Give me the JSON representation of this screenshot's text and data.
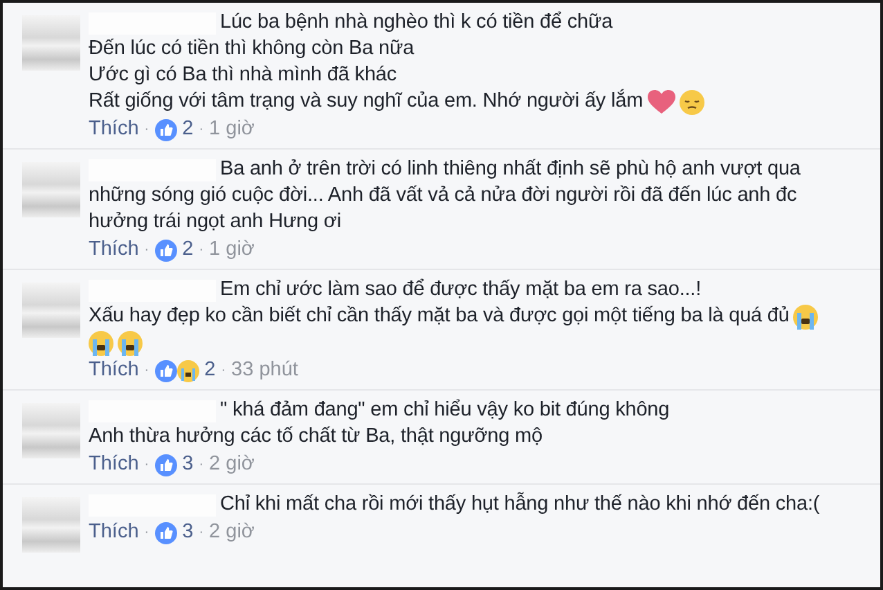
{
  "comments": [
    {
      "lines": [
        {
          "text": "Lúc ba bệnh nhà nghèo thì k có tiền để chữa"
        },
        {
          "text": "Đến lúc có tiền thì không còn Ba nữa"
        },
        {
          "text": "Ước gì có Ba thì nhà mình đã khác"
        },
        {
          "text": "Rất giống với tâm trạng và suy nghĩ của em. Nhớ người ấy lắm",
          "emojis": [
            {
              "kind": "heart"
            },
            {
              "kind": "sad"
            }
          ]
        }
      ],
      "like_label": "Thích",
      "separators": [
        "·",
        "·"
      ],
      "reactions": [
        {
          "kind": "like"
        }
      ],
      "count": "2",
      "time": "1 giờ"
    },
    {
      "lines": [
        {
          "text": "Ba anh ở trên trời có linh thiêng nhất định sẽ phù hộ anh vượt qua"
        },
        {
          "text": "những sóng gió cuộc đời... Anh đã vất vả cả nửa đời người rồi đã đến lúc anh đc"
        },
        {
          "text": "hưởng trái ngọt anh Hưng ơi"
        }
      ],
      "like_label": "Thích",
      "separators": [
        "·",
        "·"
      ],
      "reactions": [
        {
          "kind": "like"
        }
      ],
      "count": "2",
      "time": "1 giờ"
    },
    {
      "lines": [
        {
          "text": "Em chỉ ước làm sao để được thấy mặt ba em ra sao...!"
        },
        {
          "text": "Xấu hay đẹp ko cần biết chỉ cần thấy mặt ba và được gọi một tiếng ba là quá đủ",
          "emojis": [
            {
              "kind": "cry"
            }
          ]
        },
        {
          "emojis": [
            {
              "kind": "cry"
            },
            {
              "kind": "cry"
            }
          ]
        }
      ],
      "like_label": "Thích",
      "separators": [
        "·",
        "·"
      ],
      "reactions": [
        {
          "kind": "like"
        },
        {
          "kind": "sad"
        }
      ],
      "count": "2",
      "time": "33 phút"
    },
    {
      "lines": [
        {
          "text": "\" khá đảm đang\" em chỉ hiểu vậy ko bit đúng không"
        },
        {
          "text": "Anh thừa hưởng các tố chất từ Ba, thật ngưỡng mộ"
        }
      ],
      "like_label": "Thích",
      "separators": [
        "·",
        "·"
      ],
      "reactions": [
        {
          "kind": "like"
        }
      ],
      "count": "3",
      "time": "2 giờ"
    },
    {
      "lines": [
        {
          "text": "Chỉ khi mất cha rồi mới thấy hụt hẫng như thế nào khi nhớ đến cha:("
        }
      ],
      "like_label": "Thích",
      "separators": [
        "·",
        "·"
      ],
      "reactions": [
        {
          "kind": "like"
        }
      ],
      "count": "3",
      "time": "2 giờ"
    }
  ]
}
